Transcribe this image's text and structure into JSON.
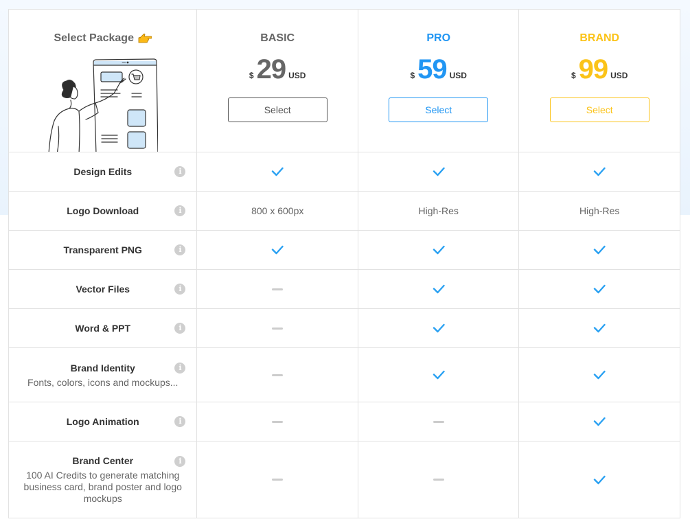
{
  "header": {
    "title": "Select Package",
    "title_icon": "pointing-hand-icon",
    "illustration": "person-pointing-at-shopping-cart-illustration"
  },
  "colors": {
    "basic": "#666666",
    "pro": "#2196f3",
    "brand": "#fbc318",
    "check": "#2aa1f2",
    "dash": "#cccccc"
  },
  "plans": [
    {
      "name": "BASIC",
      "currency_symbol": "$",
      "price": "29",
      "currency_code": "USD",
      "button_label": "Select"
    },
    {
      "name": "PRO",
      "currency_symbol": "$",
      "price": "59",
      "currency_code": "USD",
      "button_label": "Select"
    },
    {
      "name": "BRAND",
      "currency_symbol": "$",
      "price": "99",
      "currency_code": "USD",
      "button_label": "Select"
    }
  ],
  "features": [
    {
      "name": "Design Edits",
      "description": "",
      "values": [
        {
          "type": "check"
        },
        {
          "type": "check"
        },
        {
          "type": "check"
        }
      ]
    },
    {
      "name": "Logo Download",
      "description": "",
      "values": [
        {
          "type": "text",
          "text": "800 x 600px"
        },
        {
          "type": "text",
          "text": "High-Res"
        },
        {
          "type": "text",
          "text": "High-Res"
        }
      ]
    },
    {
      "name": "Transparent PNG",
      "description": "",
      "values": [
        {
          "type": "check"
        },
        {
          "type": "check"
        },
        {
          "type": "check"
        }
      ]
    },
    {
      "name": "Vector Files",
      "description": "",
      "values": [
        {
          "type": "dash"
        },
        {
          "type": "check"
        },
        {
          "type": "check"
        }
      ]
    },
    {
      "name": "Word & PPT",
      "description": "",
      "values": [
        {
          "type": "dash"
        },
        {
          "type": "check"
        },
        {
          "type": "check"
        }
      ]
    },
    {
      "name": "Brand Identity",
      "description": "Fonts, colors, icons and mockups...",
      "values": [
        {
          "type": "dash"
        },
        {
          "type": "check"
        },
        {
          "type": "check"
        }
      ]
    },
    {
      "name": "Logo Animation",
      "description": "",
      "values": [
        {
          "type": "dash"
        },
        {
          "type": "dash"
        },
        {
          "type": "check"
        }
      ]
    },
    {
      "name": "Brand Center",
      "description": "100 AI Credits to generate matching business card, brand poster and logo mockups",
      "values": [
        {
          "type": "dash"
        },
        {
          "type": "dash"
        },
        {
          "type": "check"
        }
      ]
    }
  ]
}
